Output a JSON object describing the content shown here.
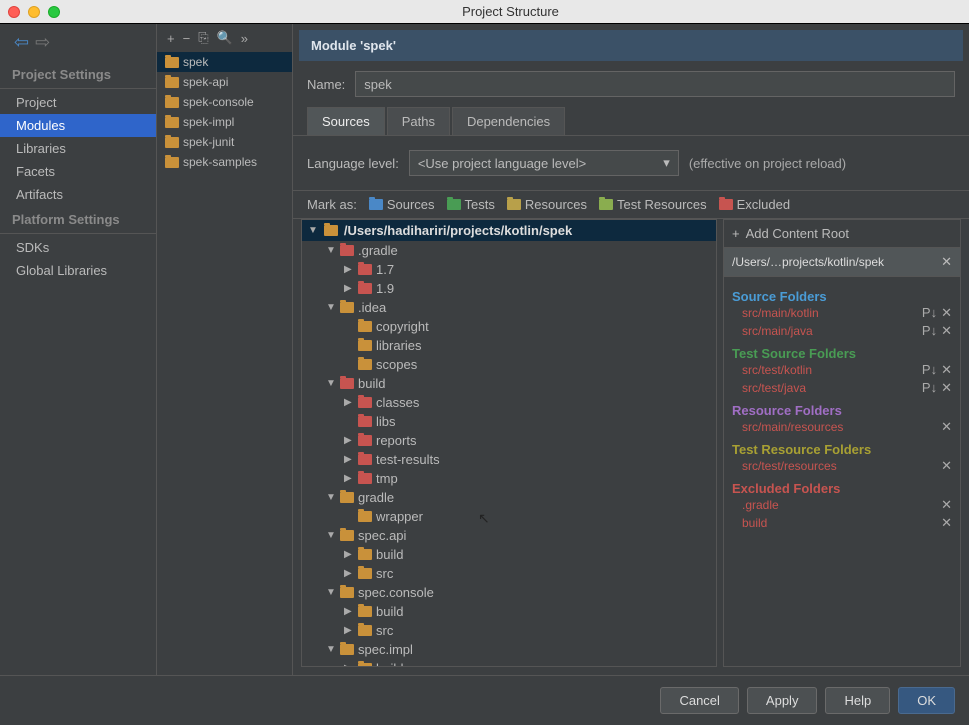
{
  "window": {
    "title": "Project Structure"
  },
  "nav": {
    "section1": "Project Settings",
    "items1": [
      "Project",
      "Modules",
      "Libraries",
      "Facets",
      "Artifacts"
    ],
    "selected1": "Modules",
    "section2": "Platform Settings",
    "items2": [
      "SDKs",
      "Global Libraries"
    ]
  },
  "modules": {
    "list": [
      "spek",
      "spek-api",
      "spek-console",
      "spek-impl",
      "spek-junit",
      "spek-samples"
    ],
    "selected": "spek"
  },
  "detail": {
    "header": "Module 'spek'",
    "name_label": "Name:",
    "name_value": "spek",
    "tabs": [
      "Sources",
      "Paths",
      "Dependencies"
    ],
    "active_tab": "Sources",
    "lang_label": "Language level:",
    "lang_value": "<Use project language level>",
    "effective": "(effective on project reload)"
  },
  "mark": {
    "label": "Mark as:",
    "sources": "Sources",
    "tests": "Tests",
    "resources": "Resources",
    "test_resources": "Test Resources",
    "excluded": "Excluded"
  },
  "tree": {
    "root": "/Users/hadihariri/projects/kotlin/spek",
    "nodes": [
      {
        "indent": 1,
        "disclosure": "▼",
        "icon": "fi-red",
        "label": ".gradle"
      },
      {
        "indent": 2,
        "disclosure": "▶",
        "icon": "fi-red",
        "label": "1.7"
      },
      {
        "indent": 2,
        "disclosure": "▶",
        "icon": "fi-red",
        "label": "1.9"
      },
      {
        "indent": 1,
        "disclosure": "▼",
        "icon": "fi-plain",
        "label": ".idea"
      },
      {
        "indent": 2,
        "disclosure": "",
        "icon": "fi-plain",
        "label": "copyright"
      },
      {
        "indent": 2,
        "disclosure": "",
        "icon": "fi-plain",
        "label": "libraries"
      },
      {
        "indent": 2,
        "disclosure": "",
        "icon": "fi-plain",
        "label": "scopes"
      },
      {
        "indent": 1,
        "disclosure": "▼",
        "icon": "fi-red",
        "label": "build"
      },
      {
        "indent": 2,
        "disclosure": "▶",
        "icon": "fi-red",
        "label": "classes"
      },
      {
        "indent": 2,
        "disclosure": "",
        "icon": "fi-red",
        "label": "libs"
      },
      {
        "indent": 2,
        "disclosure": "▶",
        "icon": "fi-red",
        "label": "reports"
      },
      {
        "indent": 2,
        "disclosure": "▶",
        "icon": "fi-red",
        "label": "test-results"
      },
      {
        "indent": 2,
        "disclosure": "▶",
        "icon": "fi-red",
        "label": "tmp"
      },
      {
        "indent": 1,
        "disclosure": "▼",
        "icon": "fi-plain",
        "label": "gradle"
      },
      {
        "indent": 2,
        "disclosure": "",
        "icon": "fi-plain",
        "label": "wrapper"
      },
      {
        "indent": 1,
        "disclosure": "▼",
        "icon": "fi-plain",
        "label": "spec.api"
      },
      {
        "indent": 2,
        "disclosure": "▶",
        "icon": "fi-plain",
        "label": "build"
      },
      {
        "indent": 2,
        "disclosure": "▶",
        "icon": "fi-plain",
        "label": "src"
      },
      {
        "indent": 1,
        "disclosure": "▼",
        "icon": "fi-plain",
        "label": "spec.console"
      },
      {
        "indent": 2,
        "disclosure": "▶",
        "icon": "fi-plain",
        "label": "build"
      },
      {
        "indent": 2,
        "disclosure": "▶",
        "icon": "fi-plain",
        "label": "src"
      },
      {
        "indent": 1,
        "disclosure": "▼",
        "icon": "fi-plain",
        "label": "spec.impl"
      },
      {
        "indent": 2,
        "disclosure": "▶",
        "icon": "fi-plain",
        "label": "build"
      }
    ]
  },
  "roots": {
    "add": "Add Content Root",
    "path": "/Users/…projects/kotlin/spek",
    "sections": [
      {
        "title": "Source Folders",
        "class": "t-blue",
        "items": [
          {
            "name": "src/main/kotlin",
            "p": true
          },
          {
            "name": "src/main/java",
            "p": true
          }
        ]
      },
      {
        "title": "Test Source Folders",
        "class": "t-green",
        "items": [
          {
            "name": "src/test/kotlin",
            "p": true
          },
          {
            "name": "src/test/java",
            "p": true
          }
        ]
      },
      {
        "title": "Resource Folders",
        "class": "t-purple",
        "items": [
          {
            "name": "src/main/resources",
            "p": false
          }
        ]
      },
      {
        "title": "Test Resource Folders",
        "class": "t-yellow",
        "items": [
          {
            "name": "src/test/resources",
            "p": false
          }
        ]
      },
      {
        "title": "Excluded Folders",
        "class": "t-red",
        "items": [
          {
            "name": ".gradle",
            "p": false
          },
          {
            "name": "build",
            "p": false
          }
        ]
      }
    ]
  },
  "footer": {
    "cancel": "Cancel",
    "apply": "Apply",
    "help": "Help",
    "ok": "OK"
  }
}
